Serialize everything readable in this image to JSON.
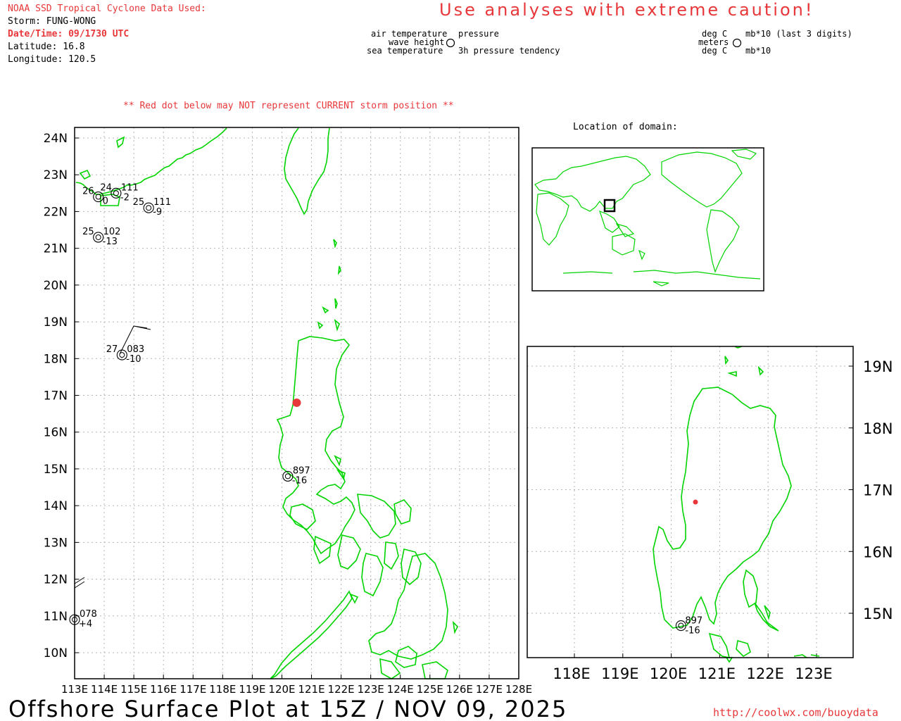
{
  "header": {
    "source_line": "NOAA SSD Tropical Cyclone Data Used:",
    "storm_line": "Storm: FUNG-WONG",
    "datetime_line": "Date/Time: 09/1730 UTC",
    "latitude_line": "Latitude: 16.8",
    "longitude_line": "Longitude: 120.5",
    "caution": "Use analyses with extreme caution!",
    "red_dot_notice": "** Red dot below may NOT represent CURRENT storm position **"
  },
  "legend": {
    "air_temperature": "air temperature",
    "wave_height": "wave height",
    "sea_temperature": "sea temperature",
    "pressure": "pressure",
    "pressure_tendency": "3h pressure tendency",
    "deg_c_top": "deg C",
    "meters": "meters",
    "deg_c_bottom": "deg C",
    "mb_last3": "mb*10 (last 3 digits)",
    "mb10": "mb*10"
  },
  "inset_title": "Location of domain:",
  "footer": {
    "plot_title": "Offshore Surface Plot at 15Z / NOV 09, 2025",
    "url": "http://coolwx.com/buoydata"
  },
  "main_map": {
    "lat_labels": [
      "24N",
      "23N",
      "22N",
      "21N",
      "20N",
      "19N",
      "18N",
      "17N",
      "16N",
      "15N",
      "14N",
      "13N",
      "12N",
      "11N",
      "10N"
    ],
    "lon_labels": [
      "113E",
      "114E",
      "115E",
      "116E",
      "117E",
      "118E",
      "119E",
      "120E",
      "121E",
      "122E",
      "123E",
      "124E",
      "125E",
      "126E",
      "127E",
      "128E"
    ],
    "storm_lat": 16.8,
    "storm_lon": 120.5,
    "stations": [
      {
        "id": "s1",
        "lat": 22.4,
        "lon": 113.8,
        "temp": "26",
        "pressure": "",
        "tendency": "0"
      },
      {
        "id": "s2",
        "lat": 22.5,
        "lon": 114.4,
        "temp": "24",
        "pressure": "111",
        "tendency": "-2"
      },
      {
        "id": "s3",
        "lat": 22.1,
        "lon": 115.5,
        "temp": "25",
        "pressure": "111",
        "tendency": "-9"
      },
      {
        "id": "s4",
        "lat": 21.3,
        "lon": 113.8,
        "temp": "25",
        "pressure": "102",
        "tendency": "-13"
      },
      {
        "id": "s5",
        "lat": 18.1,
        "lon": 114.6,
        "temp": "27",
        "pressure": "083",
        "tendency": "-10"
      },
      {
        "id": "s6",
        "lat": 14.8,
        "lon": 120.2,
        "temp": "",
        "pressure": "897",
        "tendency": "-16"
      },
      {
        "id": "s7",
        "lat": 10.9,
        "lon": 113.0,
        "temp": "",
        "pressure": "078",
        "tendency": "+4"
      }
    ]
  },
  "zoom_map": {
    "lat_labels": [
      "19N",
      "18N",
      "17N",
      "16N",
      "15N"
    ],
    "lon_labels": [
      "118E",
      "119E",
      "120E",
      "121E",
      "122E",
      "123E"
    ],
    "station": {
      "lat": 14.8,
      "lon": 120.2,
      "pressure": "897",
      "tendency": "-16"
    }
  },
  "colors": {
    "coast": "#00d400",
    "storm_dot": "#e8373a",
    "notice_red": "#e8373a"
  }
}
